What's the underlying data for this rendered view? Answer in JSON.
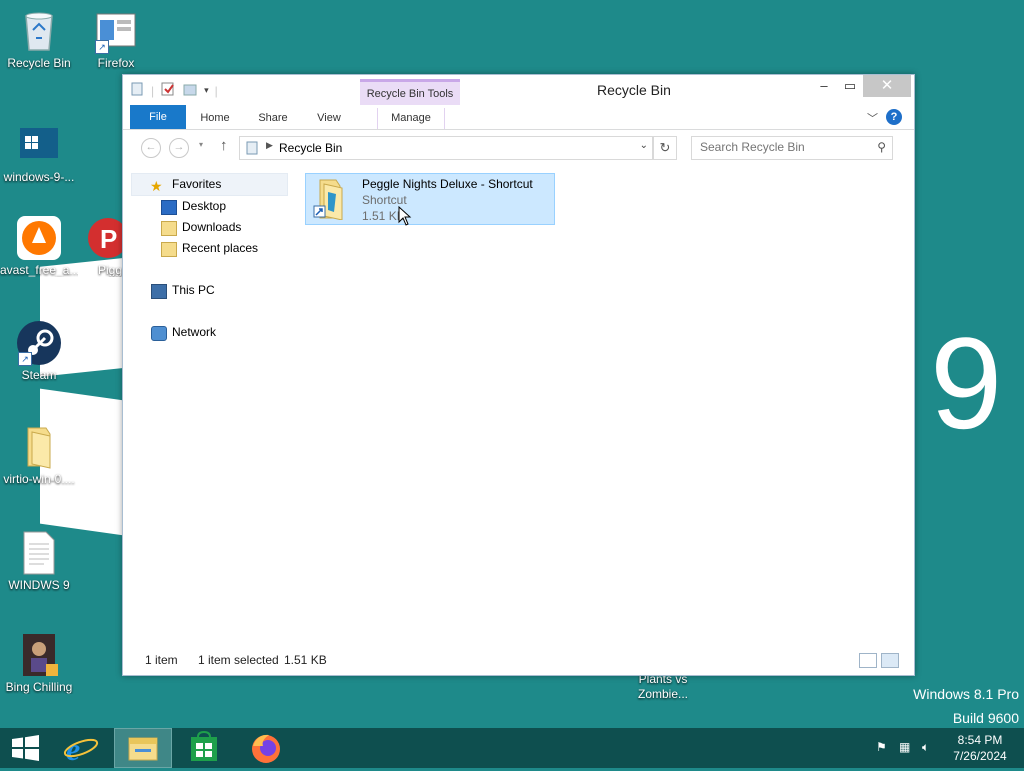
{
  "desktop": {
    "icons": [
      {
        "label": "Recycle Bin"
      },
      {
        "label": "Firefox"
      },
      {
        "label": "windows-9-..."
      },
      {
        "label": "avast_free_a..."
      },
      {
        "label": "Pigg"
      },
      {
        "label": "Steam"
      },
      {
        "label": "virtio-win-0...."
      },
      {
        "label": "WINDWS 9"
      },
      {
        "label": "Bing Chilling"
      },
      {
        "label": "Plants vs Zombie..."
      }
    ],
    "big_nine": "9",
    "watermark": {
      "line1": "Windows 8.1 Pro",
      "line2": "Build 9600"
    }
  },
  "window": {
    "title": "Recycle Bin",
    "tools_tab": "Recycle Bin Tools",
    "ribbon_tabs": {
      "file": "File",
      "home": "Home",
      "share": "Share",
      "view": "View",
      "manage": "Manage"
    },
    "address": "Recycle Bin",
    "search_placeholder": "Search Recycle Bin",
    "nav": {
      "favorites": "Favorites",
      "desktop": "Desktop",
      "downloads": "Downloads",
      "recent": "Recent places",
      "this_pc": "This PC",
      "network": "Network"
    },
    "item": {
      "name": "Peggle Nights Deluxe - Shortcut",
      "kind": "Shortcut",
      "size": "1.51 KB"
    },
    "status": {
      "count": "1 item",
      "selected": "1 item selected",
      "size": "1.51 KB"
    }
  },
  "taskbar": {
    "time": "8:54 PM",
    "date": "7/26/2024"
  },
  "colors": {
    "desktop": "#1e8a8a",
    "taskbar": "#0e4f4f",
    "ribbon_file": "#1979ca",
    "selection": "#cce8ff"
  }
}
